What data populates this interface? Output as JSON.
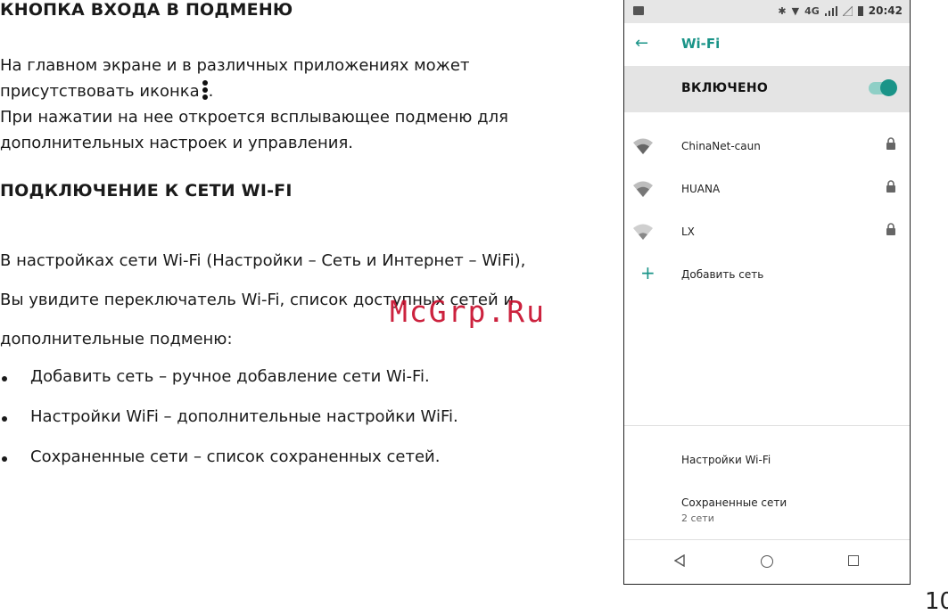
{
  "section1": {
    "title": "КНОПКА ВХОДА В ПОДМЕНЮ",
    "line1": "На главном экране и в различных приложениях может",
    "line2_before": "присутствовать иконка",
    "line2_after": ".",
    "line3": "При нажатии на нее откроется всплывающее подменю для",
    "line4": "дополнительных настроек и управления."
  },
  "section2": {
    "title": "ПОДКЛЮЧЕНИЕ К СЕТИ WI-FI",
    "line1": "В настройках сети Wi-Fi (Настройки – Сеть и Интернет – WiFi),",
    "line2": "Вы увидите переключатель Wi-Fi, список доступных сетей и",
    "line3": "дополнительные подменю:",
    "bullets": [
      "Добавить сеть – ручное добавление сети Wi-Fi.",
      "Настройки WiFi – дополнительные настройки WiFi.",
      "Сохраненные сети – список сохраненных сетей."
    ]
  },
  "watermark": "McGrp.Ru",
  "page_number": "10",
  "phone": {
    "status_bar": {
      "network": "4G",
      "time": "20:42"
    },
    "app_bar": {
      "title": "Wi-Fi",
      "back_icon": "arrow-left-icon"
    },
    "toggle": {
      "label": "ВКЛЮЧЕНО",
      "state": "on"
    },
    "networks": [
      {
        "name": "ChinaNet-caun",
        "secured": true
      },
      {
        "name": "HUANA",
        "secured": true
      },
      {
        "name": "LX",
        "secured": true
      }
    ],
    "add_network": "Добавить сеть",
    "menu": {
      "wifi_settings": "Настройки Wi-Fi",
      "saved_networks": "Сохраненные сети",
      "saved_count": "2 сети"
    },
    "accent_color": "#1a9488"
  }
}
